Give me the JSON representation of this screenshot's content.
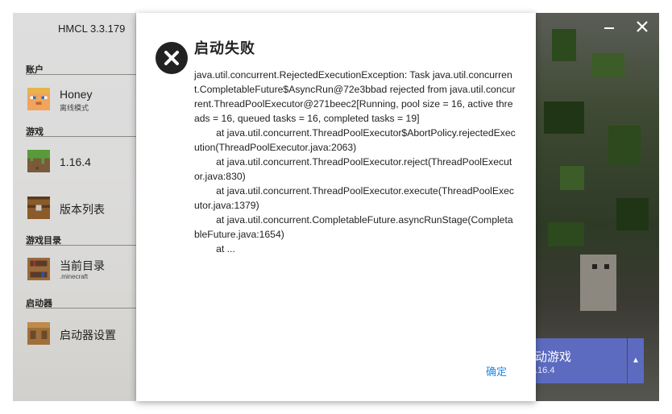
{
  "app": {
    "title": "HMCL 3.3.179"
  },
  "sidebar": {
    "sections": {
      "account": "账户",
      "game": "游戏",
      "game_dir": "游戏目录",
      "launcher": "启动器"
    },
    "account": {
      "name": "Honey",
      "mode": "离线模式",
      "icon": "steve-head-icon"
    },
    "items": [
      {
        "label": "1.16.4",
        "icon": "grass-block-icon"
      },
      {
        "label": "版本列表",
        "icon": "chest-icon"
      },
      {
        "label": "当前目录",
        "sub": ".minecraft",
        "icon": "bookshelf-icon"
      },
      {
        "label": "启动器设置",
        "icon": "crafting-table-icon"
      }
    ]
  },
  "launch": {
    "label": "动游戏",
    "version": ".16.4",
    "menu_arrow": "▲"
  },
  "window_controls": {
    "minimize": "—",
    "close": "✕"
  },
  "dialog": {
    "title": "启动失败",
    "icon": "error-circle-icon",
    "message": "java.util.concurrent.RejectedExecutionException: Task java.util.concurrent.CompletableFuture$AsyncRun@72e3bbad rejected from java.util.concurrent.ThreadPoolExecutor@271beec2[Running, pool size = 16, active threads = 16, queued tasks = 16, completed tasks = 19]\n\tat java.util.concurrent.ThreadPoolExecutor$AbortPolicy.rejectedExecution(ThreadPoolExecutor.java:2063)\n\tat java.util.concurrent.ThreadPoolExecutor.reject(ThreadPoolExecutor.java:830)\n\tat java.util.concurrent.ThreadPoolExecutor.execute(ThreadPoolExecutor.java:1379)\n\tat java.util.concurrent.CompletableFuture.asyncRunStage(CompletableFuture.java:1654)\n\tat ...",
    "ok_label": "确定"
  },
  "colors": {
    "accent": "#5c6bc0",
    "link": "#1e88e5",
    "error": "#222222"
  }
}
